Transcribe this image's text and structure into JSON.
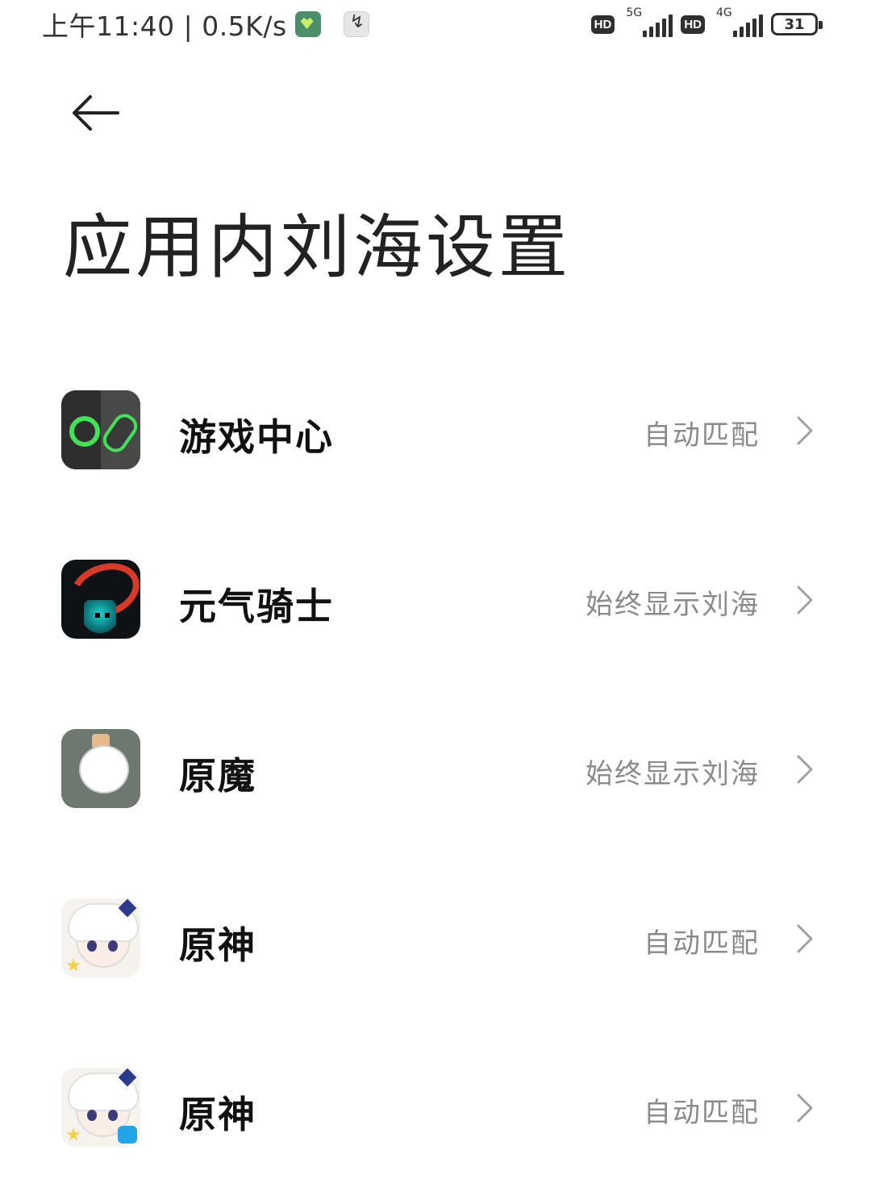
{
  "status_bar": {
    "time_speed": "上午11:40 | 0.5K/s",
    "hd1": "HD",
    "net1": "5G",
    "hd2": "HD",
    "net2": "4G",
    "battery": "31"
  },
  "header": {
    "back_icon": "arrow-left-icon",
    "title": "应用内刘海设置"
  },
  "apps": [
    {
      "name": "游戏中心",
      "status": "自动匹配",
      "icon": "game-center-icon"
    },
    {
      "name": "元气骑士",
      "status": "始终显示刘海",
      "icon": "soul-knight-icon"
    },
    {
      "name": "原魔",
      "status": "始终显示刘海",
      "icon": "yuanmo-icon"
    },
    {
      "name": "原神",
      "status": "自动匹配",
      "icon": "genshin-icon"
    },
    {
      "name": "原神",
      "status": "自动匹配",
      "icon": "genshin-bilibili-icon"
    }
  ]
}
